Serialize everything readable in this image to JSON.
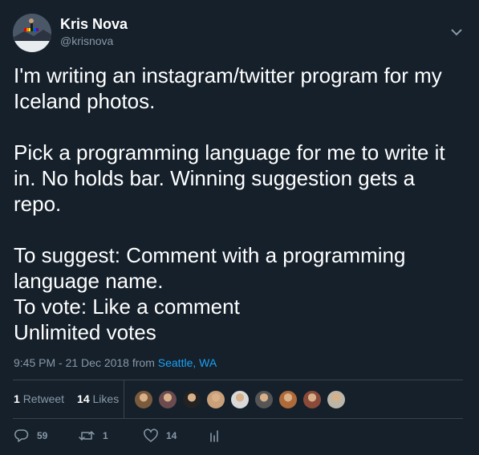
{
  "author": {
    "name": "Kris Nova",
    "handle": "@krisnova"
  },
  "tweet": {
    "paragraphs": [
      "I'm writing an instagram/twitter program for my Iceland photos.",
      "Pick a programming language for me to write it in. No holds bar. Winning suggestion gets a repo.",
      "To suggest: Comment with a programming language name.\nTo vote: Like a comment\nUnlimited votes"
    ]
  },
  "meta": {
    "time": "9:45 PM - 21 Dec 2018",
    "from_label": "from",
    "location": "Seattle, WA"
  },
  "stats": {
    "retweets_count": "1",
    "retweets_label": "Retweet",
    "likes_count": "14",
    "likes_label": "Likes"
  },
  "likers": [
    "#7a5a3c",
    "#6b4b50",
    "#222222",
    "#c9a07a",
    "#d9d9d9",
    "#555555",
    "#b06a3a",
    "#8a4a3a",
    "#bcb6a8"
  ],
  "actions": {
    "replies": "59",
    "retweets": "1",
    "likes": "14"
  },
  "icons": {
    "menu": "chevron-down-icon",
    "reply": "reply-icon",
    "retweet": "retweet-icon",
    "like": "heart-icon",
    "analytics": "analytics-icon"
  },
  "colors": {
    "background": "#15202b",
    "secondary_text": "#8899a6",
    "link": "#1da1f2",
    "divider": "#38444d"
  }
}
